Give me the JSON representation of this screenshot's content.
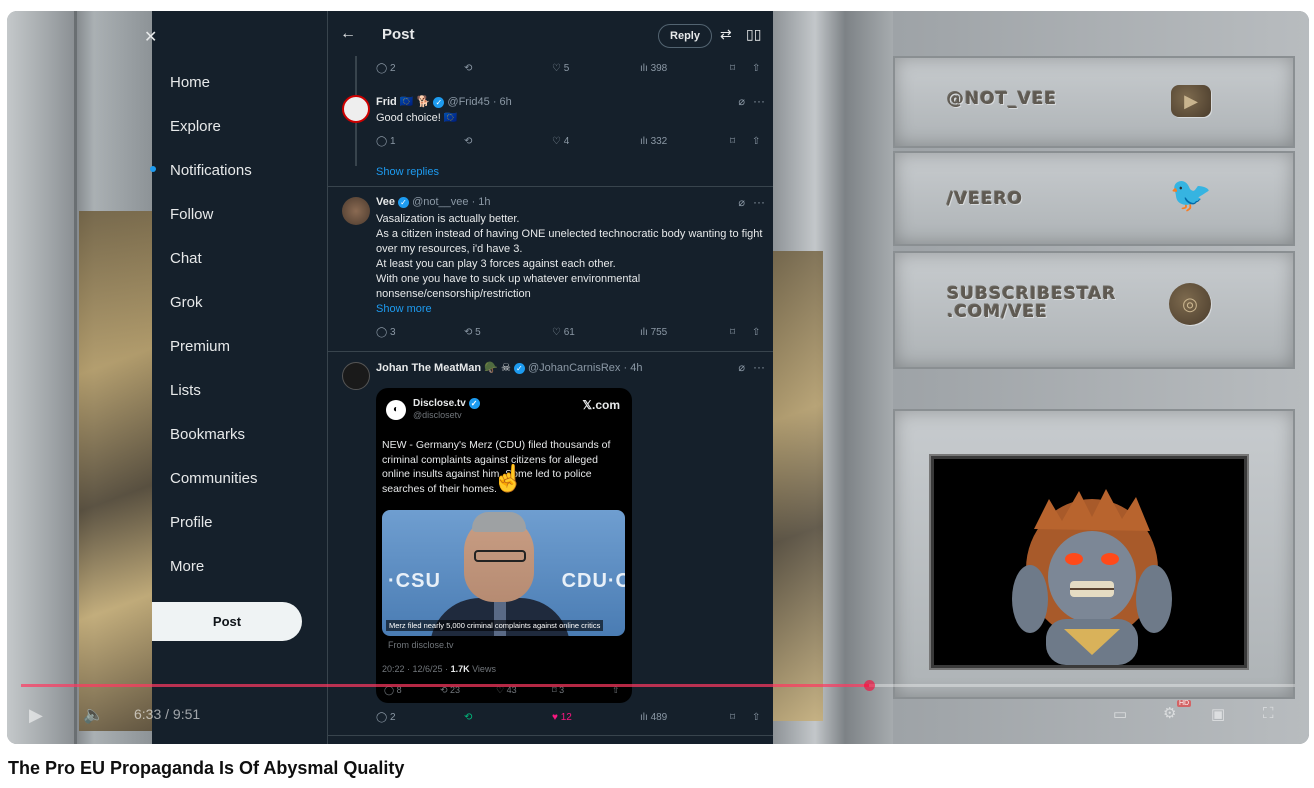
{
  "video": {
    "title": "The Pro EU Propaganda Is Of Abysmal Quality",
    "time_display": "6:33 / 9:51",
    "progress": 0.666,
    "hd_badge": "HD"
  },
  "overlay": {
    "handle_1": "@NOT_VEE",
    "handle_2": "/VEERO",
    "handle_3_line1": "SUBSCRIBESTAR",
    "handle_3_line2": ".COM/VEE"
  },
  "x": {
    "nav": [
      "Home",
      "Explore",
      "Notifications",
      "Follow",
      "Chat",
      "Grok",
      "Premium",
      "Lists",
      "Bookmarks",
      "Communities",
      "Profile",
      "More"
    ],
    "post_button": "Post",
    "header_title": "Post",
    "reply_button": "Reply",
    "top_actions": {
      "replies": "2",
      "reposts": "",
      "likes": "5",
      "views": "398"
    },
    "tweet_frid": {
      "name": "Frid",
      "emojis": "🇪🇺 🐕",
      "handle_time": "@Frid45 · 6h",
      "text": "Good choice! 🇪🇺",
      "replies": "1",
      "reposts": "",
      "likes": "4",
      "views": "332"
    },
    "show_replies": "Show replies",
    "tweet_vee": {
      "name": "Vee",
      "handle_time": "@not__vee · 1h",
      "lines": [
        "Vasalization is actually better.",
        "As a citizen instead of having ONE unelected technocratic body wanting to fight over my resources, i'd have 3.",
        "At least you can play 3 forces against each other.",
        "With one you have to suck up whatever environmental nonsense/censorship/restriction"
      ],
      "show_more": "Show more",
      "replies": "3",
      "reposts": "5",
      "likes": "61",
      "views": "755"
    },
    "tweet_johan": {
      "name": "Johan The MeatMan",
      "emojis": "🪖 ☠",
      "handle_time": "@JohanCarnisRex · 4h",
      "replies": "2",
      "reposts": "",
      "likes": "12",
      "views": "489"
    },
    "card": {
      "source_name": "Disclose.tv",
      "source_handle": "@disclosetv",
      "brand": "𝕏.com",
      "text": "NEW - Germany's Merz (CDU) filed thousands of criminal complaints against citizens for alleged online insults against him. Some led to police searches of their homes.",
      "photo_caption": "Merz filed nearly 5,000 criminal complaints against online critics",
      "photo_label_left": "·CSU",
      "photo_label_right": "CDU·C",
      "from": "From disclose.tv",
      "timestamp": "20:22 · 12/6/25 ·",
      "views_count": "1.7K",
      "views_label": "Views",
      "replies": "8",
      "reposts": "23",
      "likes": "43",
      "bookmarks": "3"
    }
  },
  "colors": {
    "x_bg": "#15202b",
    "accent": "#1d9bf0",
    "like": "#f91880",
    "repost_active": "#00ba7c"
  }
}
